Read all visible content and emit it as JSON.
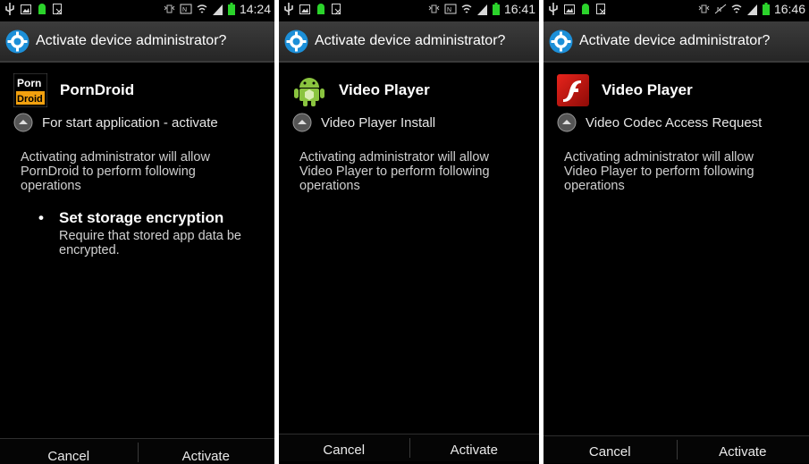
{
  "colors": {
    "title_bar": "#2f2f2f",
    "background": "#000000",
    "battery": "#2bd32b",
    "accent": "#1c8fd8"
  },
  "panels": [
    {
      "status": {
        "time": "14:24"
      },
      "title": "Activate device administrator?",
      "app": {
        "name": "PornDroid",
        "icon": "porndroid-icon",
        "icon_text_top": "Porn",
        "icon_text_bottom": "Droid"
      },
      "description": "For start application - activate",
      "body": "Activating administrator will allow PornDroid to perform following operations",
      "policies": [
        {
          "title": "Set storage encryption",
          "desc": "Require that stored app data be encrypted."
        }
      ],
      "buttons": {
        "cancel": "Cancel",
        "activate": "Activate"
      }
    },
    {
      "status": {
        "time": "16:41"
      },
      "title": "Activate device administrator?",
      "app": {
        "name": "Video Player",
        "icon": "android-icon"
      },
      "description": "Video Player Install",
      "body": "Activating administrator will allow Video Player to perform following operations",
      "buttons": {
        "cancel": "Cancel",
        "activate": "Activate"
      }
    },
    {
      "status": {
        "time": "16:46"
      },
      "title": "Activate device administrator?",
      "app": {
        "name": "Video Player",
        "icon": "flash-icon"
      },
      "description": "Video Codec Access Request",
      "body": "Activating administrator will allow Video Player to perform following operations",
      "buttons": {
        "cancel": "Cancel",
        "activate": "Activate"
      }
    }
  ]
}
